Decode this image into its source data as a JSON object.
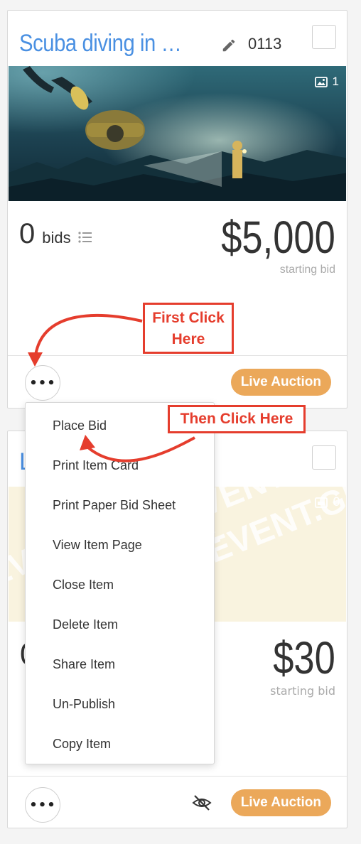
{
  "card1": {
    "title": "Scuba diving in the L...",
    "item_number": "0113",
    "image_count": "1",
    "bids_count": "0",
    "bids_label": "bids",
    "price": "$5,000",
    "price_label": "starting bid",
    "more_label": "•••",
    "badge": "Live Auction"
  },
  "card2": {
    "title_fragment": "L",
    "image_count": "0",
    "bids_fragment": "0",
    "price": "$30",
    "price_label": "starting bid",
    "more_label": "•••",
    "badge": "Live Auction",
    "watermark_text": "EVENT.GIVE"
  },
  "menu": {
    "items": [
      {
        "label": "Place Bid"
      },
      {
        "label": "Print Item Card"
      },
      {
        "label": "Print Paper Bid Sheet"
      },
      {
        "label": "View Item Page"
      },
      {
        "label": "Close Item"
      },
      {
        "label": "Delete Item"
      },
      {
        "label": "Share Item"
      },
      {
        "label": "Un-Publish"
      },
      {
        "label": "Copy Item"
      }
    ]
  },
  "annotations": {
    "first": "First Click Here",
    "first_line1": "First Click",
    "first_line2": "Here",
    "second": "Then Click Here"
  },
  "colors": {
    "title_blue": "#4a90e2",
    "badge_orange": "#eba85a",
    "annotation_red": "#e53d2d"
  }
}
